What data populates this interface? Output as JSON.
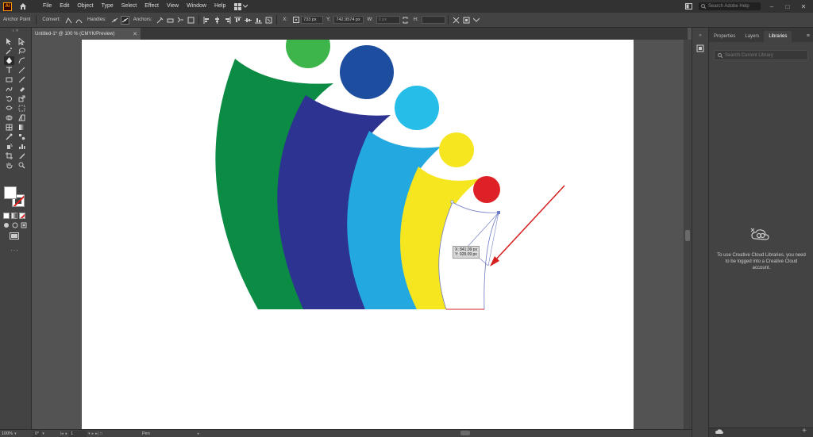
{
  "app": {
    "logo_text": "Ai"
  },
  "menu": [
    "File",
    "Edit",
    "Object",
    "Type",
    "Select",
    "Effect",
    "View",
    "Window",
    "Help"
  ],
  "search": {
    "placeholder": "Search Adobe Help"
  },
  "control_bar": {
    "tool_label": "Anchor Point",
    "convert_label": "Convert:",
    "handles_label": "Handles:",
    "anchors_label": "Anchors:",
    "x_value": "733 px",
    "y_value": "742.9574 px",
    "w_value": "0 px"
  },
  "document_tab": {
    "title": "Untitled-1* @ 100 % (CMYK/Preview)"
  },
  "canvas": {
    "coord_x": "X: 841.09 px",
    "coord_y": "Y: 928.09 px",
    "colors": {
      "green": "#0b8b44",
      "navy": "#2d3390",
      "cyan": "#24a8e0",
      "yellow": "#f5e61f",
      "red": "#de2127",
      "green_circle": "#3db54a",
      "blue_circle": "#1c4d9e",
      "light_blue_circle": "#27bde9",
      "arrow": "#d42020",
      "selection": "#6f7bc4"
    }
  },
  "right_panel": {
    "tabs": [
      "Properties",
      "Layers",
      "Libraries"
    ],
    "active_tab": "Libraries",
    "search_placeholder": "Search Current Library",
    "message": "To use Creative Cloud Libraries, you need to be logged into a Creative Cloud account."
  },
  "status_bar": {
    "zoom": "100%",
    "rotation": "0°",
    "artboard_num": "1",
    "tool_name": "Pen"
  }
}
